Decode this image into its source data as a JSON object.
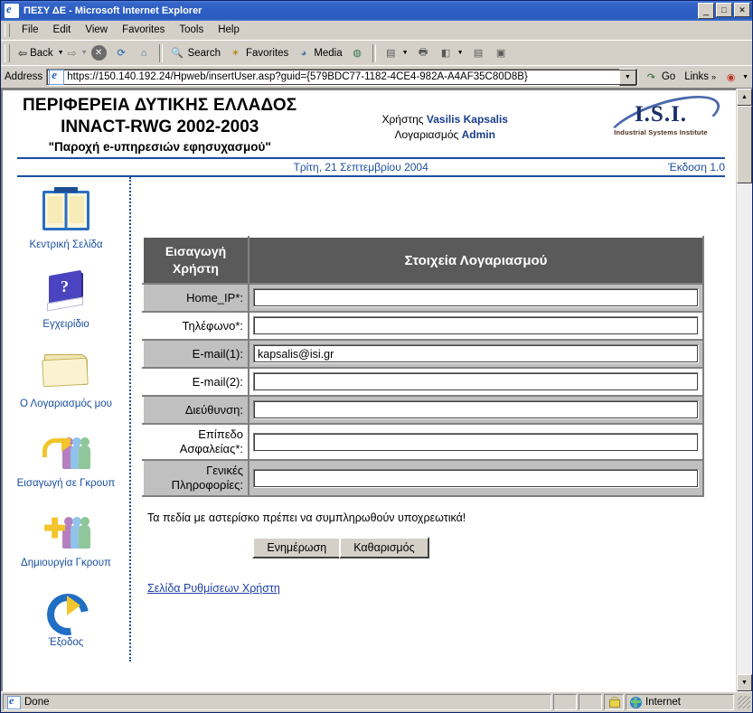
{
  "window": {
    "title": "ΠΕΣΥ ΔΕ - Microsoft Internet Explorer",
    "icon": "ie-icon",
    "minimize": "_",
    "maximize": "□",
    "close": "✕"
  },
  "menu": {
    "items": [
      "File",
      "Edit",
      "View",
      "Favorites",
      "Tools",
      "Help"
    ]
  },
  "toolbar": {
    "back": "Back",
    "forward": "",
    "stop": "✕",
    "refresh": "⟳",
    "home": "⌂",
    "search": "Search",
    "favorites": "Favorites",
    "media": "Media",
    "history": "",
    "mail": "",
    "print": "",
    "edit": "",
    "discuss": "",
    "messenger": ""
  },
  "address": {
    "label": "Address",
    "url": "https://150.140.192.24/Hpweb/insertUser.asp?guid={579BDC77-1182-4CE4-982A-A4AF35C80D8B}",
    "go": "Go",
    "links": "Links",
    "links_chevron": "»"
  },
  "page_header": {
    "line1": "ΠΕΡΙΦΕΡΕΙΑ ΔΥΤΙΚΗΣ ΕΛΛΑΔΟΣ",
    "line2": "INNACT-RWG 2002-2003",
    "line3": "\"Παροχή e-υπηρεσιών εφησυχασμού\"",
    "user_label": "Χρήστης",
    "user_name": "Vasilis Kapsalis",
    "account_label": "Λογαριασμός",
    "account_name": "Admin",
    "logo_main": "I.S.I.",
    "logo_sub": "Industrial Systems Institute",
    "date": "Τρίτη, 21 Σεπτεμβρίου 2004",
    "version": "Έκδοση 1.0",
    "accent_color": "#1a4fa0"
  },
  "sidebar": {
    "items": [
      {
        "label": "Κεντρική Σελίδα",
        "icon": "home-book-icon"
      },
      {
        "label": "Εγχειρίδιο",
        "icon": "manual-book-icon"
      },
      {
        "label": "Ο Λογαριασμός μου",
        "icon": "folder-icon"
      },
      {
        "label": "Εισαγωγή σε Γκρουπ",
        "icon": "add-to-group-icon"
      },
      {
        "label": "Δημιουργία Γκρουπ",
        "icon": "create-group-icon"
      },
      {
        "label": "Έξοδος",
        "icon": "exit-arrow-icon"
      }
    ]
  },
  "form": {
    "header_left": "Εισαγωγή Χρήστη",
    "header_right": "Στοιχεία Λογαριασμού",
    "rows": [
      {
        "label": "Home_IP*:",
        "value": "",
        "shade": "gray"
      },
      {
        "label": "Τηλέφωνο*:",
        "value": "",
        "shade": "white"
      },
      {
        "label": "E-mail(1):",
        "value": "kapsalis@isi.gr",
        "shade": "gray"
      },
      {
        "label": "E-mail(2):",
        "value": "",
        "shade": "white"
      },
      {
        "label": "Διεύθυνση:",
        "value": "",
        "shade": "gray"
      },
      {
        "label": "Επίπεδο Ασφαλείας*:",
        "value": "",
        "shade": "white"
      },
      {
        "label": "Γενικές Πληροφορίες:",
        "value": "",
        "shade": "gray"
      }
    ],
    "note": "Τα πεδία με αστερίσκο πρέπει να συμπληρωθούν υποχρεωτικά!",
    "submit_label": "Ενημέρωση",
    "reset_label": "Καθαρισμός",
    "settings_link": "Σελίδα Ρυθμίσεων Χρήστη"
  },
  "status": {
    "text": "Done",
    "zone": "Internet",
    "secure_icon": "lock-icon"
  }
}
